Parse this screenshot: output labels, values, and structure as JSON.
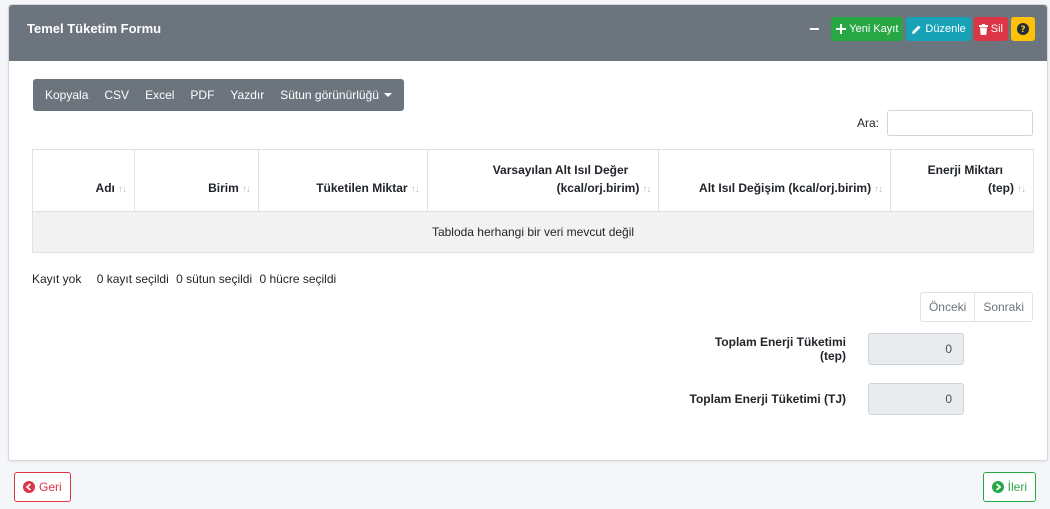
{
  "header": {
    "title": "Temel Tüketim Formu",
    "minimize_label": "−",
    "buttons": {
      "new": "Yeni Kayıt",
      "edit": "Düzenle",
      "delete": "Sil",
      "help": "?"
    }
  },
  "export_buttons": [
    "Kopyala",
    "CSV",
    "Excel",
    "PDF",
    "Yazdır",
    "Sütun görünürlüğü"
  ],
  "search": {
    "label": "Ara:",
    "value": "",
    "placeholder": ""
  },
  "table": {
    "columns": [
      {
        "line1": "",
        "line2": "Adı"
      },
      {
        "line1": "",
        "line2": "Birim"
      },
      {
        "line1": "",
        "line2": "Tüketilen Miktar"
      },
      {
        "line1": "Varsayılan Alt Isıl Değer",
        "line2": "(kcal/orj.birim)"
      },
      {
        "line1": "",
        "line2": "Alt Isıl Değişim (kcal/orj.birim)"
      },
      {
        "line1": "Enerji Miktarı",
        "line2": "(tep)"
      }
    ],
    "empty_message": "Tabloda herhangi bir veri mevcut değil"
  },
  "info": {
    "records": "Kayıt yok",
    "rows_selected": "0 kayıt seçildi",
    "columns_selected": "0 sütun seçildi",
    "cells_selected": "0 hücre seçildi"
  },
  "pagination": {
    "previous": "Önceki",
    "next": "Sonraki"
  },
  "totals": {
    "tep_label": "Toplam Enerji Tüketimi (tep)",
    "tep_value": "0",
    "tj_label": "Toplam Enerji Tüketimi (TJ)",
    "tj_value": "0"
  },
  "footer": {
    "back": "Geri",
    "next": "İleri"
  },
  "colors": {
    "header_bg": "#6c757d",
    "green": "#28a745",
    "teal": "#17a2b8",
    "red": "#dc3545",
    "yellow": "#ffc107"
  }
}
